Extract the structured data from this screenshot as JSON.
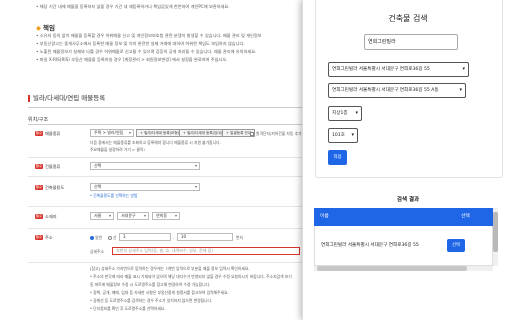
{
  "background": {
    "notice_lines": [
      "• 해당 기간 내에 매물을 등록하지 않을 경우 기간 내 재등록하거나 책임감있게 한번하여 개인PC에 보관하세요.",
      "• 소유자 동의 없이 매물을 등록할 경우 허위매물 신고 및 개인정보보호법 관련 분쟁이 발생할 수 있습니다. 매물 관리 및 개인정보",
      "• 부동산광고는 중개사무소에서 등록한 매물 정보 및 이미 완전한 실제 거래에 대하여 허위한 책임도 보임하지 않습니다.",
      "• 노출된 매물정보가 실제와 다를 경우 허위매물로 신고될 수 있으며 검증의 공개 처리될 수 있습니다. 매물 관리에 유의하세요.",
      "• 파일 X-RIS(RIS) 부동산 매물을 등록하실 경우 [계정관리 > 회원정보변경] 에서 설정을 완료하여 주십시오."
    ],
    "notice_title": "책임",
    "section_title": "빌라/다세대/연립 매물등록",
    "sub_title": "위치/구조",
    "required_tag": "필수",
    "property_type": {
      "label": "매물종류",
      "value": "주택 > 빌라/연립",
      "btn1": "+ 빌라/다세대 등록(모형)",
      "btn2": "+ 빌라/다세대 등록(임대)",
      "btn3": "+ 일괄등록 안내",
      "check_label": "원격단지/지하건물 자동 추가",
      "help1": "다음 중에서는 매물종류를 조회하고 등록해야 합니다 매물종류 시 지원 불가합니다.",
      "help2": "주요매물을 설정하려 가기 > 클릭!"
    },
    "building_type": {
      "label": "건물종류",
      "value": "선택"
    },
    "building_use": {
      "label": "건축물용도",
      "value": "선택",
      "note": "* 건축물용도를 선택하는 방법"
    },
    "location": {
      "label": "소재지",
      "city": "서울",
      "district": "서대문구",
      "dong": "연희동"
    },
    "address": {
      "label": "주소",
      "radio_general": "일반",
      "radio_mountain": "산",
      "num1": "3",
      "num2": "10",
      "unit": "번지",
      "detail_label": "상세주소",
      "detail_placeholder": "지번의 상세주소 입력(동, 층, 호, 내역보수, 일부, 전체 등)"
    },
    "address_notes": [
      "[참고] 상세주소 가지번으로 입력하는 경우에는 7개번 입력으로 부분을 매물 정보 입력시 확인하세요.",
      "* 주소의 판각에 따라 매물 표시 기재되어 있으며 해당 대다수가 반영되지 않을 경우 수정 요청하시기 바랍니다. 주소지검색 보기",
      "동 파트에 매물정보 수정 시 도로명주소를 참고해 변경하여 수정 가능합니다.",
      "* 정책, 공개, 매매, 임대 등 자세한 사항은 부동산중개 설명서를 참고하여 입력해주세요.",
      "* 경계선 등 도로명주소를 검색하는 경우 주소가 일치하지 않으면 변경됩니다.",
      "* 단지정보를 확인 후 도로명주소를 선택하세요."
    ]
  },
  "panel": {
    "title": "건축물 검색",
    "search_value": "연희그린빌라",
    "select_building": "연희그린빌라 서울특별시 서대문구 연희로36길 55",
    "select_unit": "연희그린빌라 서울특별시 서대문구 연희로36길 55 A동",
    "select_floor": "지상1층",
    "select_room": "101호",
    "confirm_button": "적용",
    "result_title": "검색 결과",
    "result_headers": [
      "이름",
      "선택"
    ],
    "result_rows": [
      {
        "name": "연희그린빌라 서울특별시 서대문구 연희로36길 55",
        "action": "선택"
      }
    ]
  },
  "colors": {
    "accent": "#1e66e6",
    "required": "#d9342b",
    "notice_icon": "#f0a020"
  }
}
